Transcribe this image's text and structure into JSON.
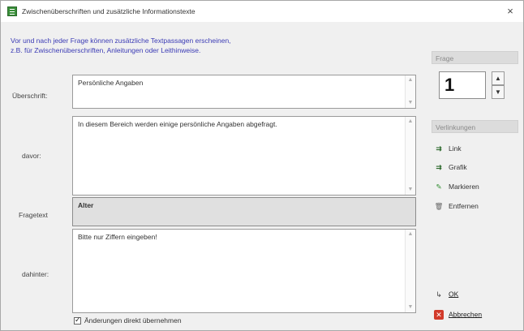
{
  "window": {
    "title": "Zwischenüberschriften und zusätzliche Informationstexte",
    "close_glyph": "×",
    "icon": "app-icon"
  },
  "info": {
    "line1": "Vor und nach jeder Frage können zusätzliche Textpassagen erscheinen,",
    "line2": "z.B. für Zwischenüberschriften, Anleitungen oder Leithinweise."
  },
  "labels": {
    "ueberschrift": "Überschrift:",
    "davor": "davor:",
    "fragetext": "Fragetext",
    "dahinter": "dahinter:"
  },
  "fields": {
    "ueberschrift_value": "Persönliche Angaben",
    "davor_value": "In diesem Bereich werden einige persönliche Angaben abgefragt.",
    "fragetext_value": "Alter",
    "dahinter_value": "Bitte nur Ziffern eingeben!"
  },
  "checkbox": {
    "label": "Änderungen direkt übernehmen",
    "checked": true
  },
  "sidebar": {
    "frage_header": "Frage",
    "frage_value": "1",
    "spin_up": "▲",
    "spin_down": "▼",
    "verlinkungen_header": "Verlinkungen",
    "items": [
      {
        "label": "Link",
        "icon": "link-icon",
        "glyph": "⇉"
      },
      {
        "label": "Grafik",
        "icon": "image-link-icon",
        "glyph": "⇉"
      },
      {
        "label": "Markieren",
        "icon": "marker-icon",
        "glyph": "✎"
      },
      {
        "label": "Entfernen",
        "icon": "trash-icon",
        "glyph": "🗑"
      }
    ]
  },
  "buttons": {
    "ok": "OK",
    "cancel": "Abbrechen",
    "ok_glyph": "↳",
    "cancel_glyph": "✕"
  },
  "colors": {
    "info_text": "#3b3bb5",
    "cancel_icon": "#d23a2a",
    "app_icon": "#3a8f3a"
  }
}
